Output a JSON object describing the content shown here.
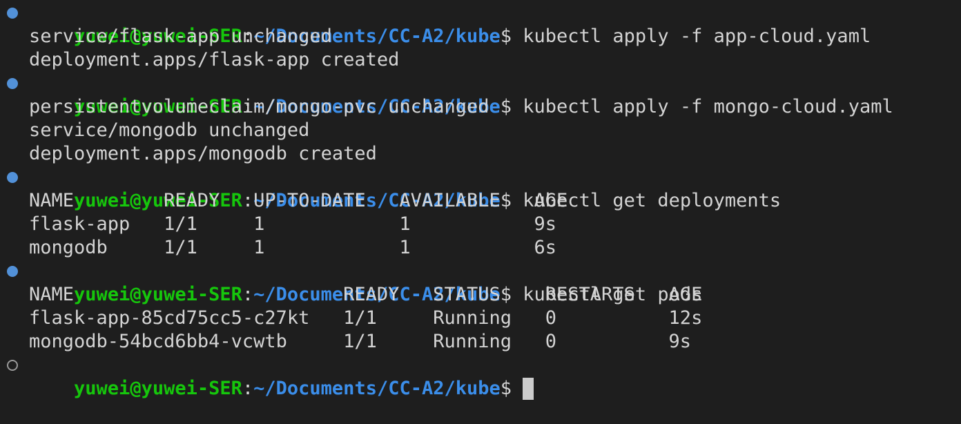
{
  "prompt": {
    "user_host": "yuwei@yuwei-SER",
    "colon": ":",
    "path": "~/Documents/CC-A2/kube",
    "dollar": "$"
  },
  "lines": [
    {
      "kind": "prompt",
      "command": " kubectl apply -f app-cloud.yaml"
    },
    {
      "kind": "output",
      "text": "service/flask-app unchanged"
    },
    {
      "kind": "output",
      "text": "deployment.apps/flask-app created"
    },
    {
      "kind": "prompt",
      "command": " kubectl apply -f mongo-cloud.yaml"
    },
    {
      "kind": "output",
      "text": "persistentvolumeclaim/mongo-pvc unchanged"
    },
    {
      "kind": "output",
      "text": "service/mongodb unchanged"
    },
    {
      "kind": "output",
      "text": "deployment.apps/mongodb created"
    },
    {
      "kind": "prompt",
      "command": " kubectl get deployments"
    },
    {
      "kind": "output",
      "text": "NAME        READY   UP-TO-DATE   AVAILABLE   AGE"
    },
    {
      "kind": "output",
      "text": "flask-app   1/1     1            1           9s"
    },
    {
      "kind": "output",
      "text": "mongodb     1/1     1            1           6s"
    },
    {
      "kind": "prompt",
      "command": " kubectl get pods"
    },
    {
      "kind": "output",
      "text": "NAME                        READY   STATUS    RESTARTS   AGE"
    },
    {
      "kind": "output",
      "text": "flask-app-85cd75cc5-c27kt   1/1     Running   0          12s"
    },
    {
      "kind": "output",
      "text": "mongodb-54bcd6bb4-vcwtb     1/1     Running   0          9s"
    },
    {
      "kind": "prompt",
      "command": " "
    }
  ],
  "colors": {
    "background": "#1e1e1e",
    "user_host": "#16c60c",
    "path": "#3b8eea",
    "text": "#d4d4d4",
    "decoration_done": "#5291d8",
    "decoration_pending": "#9a9a9a"
  }
}
